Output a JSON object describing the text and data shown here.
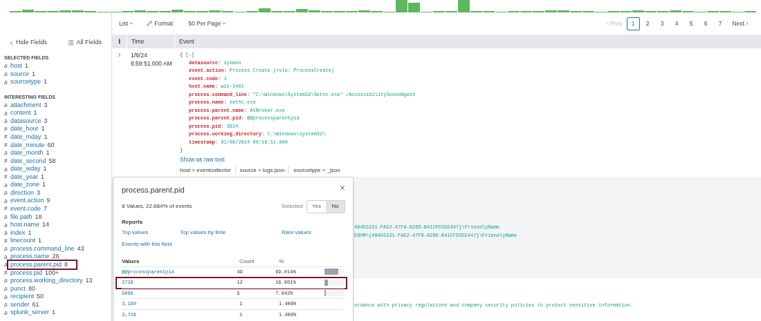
{
  "toolbar": {
    "list_menu": "List",
    "format_button": "Format",
    "per_page_menu": "50 Per Page"
  },
  "pagination": {
    "prev": {
      "label": "Prev",
      "disabled": true
    },
    "pages": [
      {
        "label": "1",
        "selected": true
      },
      {
        "label": "2",
        "selected": false
      },
      {
        "label": "3",
        "selected": false
      },
      {
        "label": "4",
        "selected": false
      },
      {
        "label": "5",
        "selected": false
      },
      {
        "label": "6",
        "selected": false
      },
      {
        "label": "7",
        "selected": false
      }
    ],
    "next": {
      "label": "Next",
      "disabled": false
    }
  },
  "sidebar": {
    "hide_fields": "Hide Fields",
    "all_fields": "All Fields",
    "selected_header": "SELECTED FIELDS",
    "selected_fields": [
      {
        "type": "a",
        "name": "host",
        "count": "1",
        "highlighted": false
      },
      {
        "type": "a",
        "name": "source",
        "count": "1",
        "highlighted": false
      },
      {
        "type": "a",
        "name": "sourcetype",
        "count": "1",
        "highlighted": false
      }
    ],
    "interesting_header": "INTERESTING FIELDS",
    "interesting_fields": [
      {
        "type": "a",
        "name": "attachment",
        "count": "3",
        "highlighted": false
      },
      {
        "type": "a",
        "name": "content",
        "count": "1",
        "highlighted": false
      },
      {
        "type": "a",
        "name": "datasource",
        "count": "3",
        "highlighted": false
      },
      {
        "type": "#",
        "name": "date_hour",
        "count": "1",
        "highlighted": false
      },
      {
        "type": "#",
        "name": "date_mday",
        "count": "1",
        "highlighted": false
      },
      {
        "type": "#",
        "name": "date_minute",
        "count": "60",
        "highlighted": false
      },
      {
        "type": "a",
        "name": "date_month",
        "count": "1",
        "highlighted": false
      },
      {
        "type": "#",
        "name": "date_second",
        "count": "58",
        "highlighted": false
      },
      {
        "type": "a",
        "name": "date_wday",
        "count": "1",
        "highlighted": false
      },
      {
        "type": "#",
        "name": "date_year",
        "count": "1",
        "highlighted": false
      },
      {
        "type": "a",
        "name": "date_zone",
        "count": "1",
        "highlighted": false
      },
      {
        "type": "a",
        "name": "direction",
        "count": "3",
        "highlighted": false
      },
      {
        "type": "a",
        "name": "event.action",
        "count": "9",
        "highlighted": false
      },
      {
        "type": "#",
        "name": "event.code",
        "count": "7",
        "highlighted": false
      },
      {
        "type": "a",
        "name": "file.path",
        "count": "18",
        "highlighted": false
      },
      {
        "type": "a",
        "name": "host.name",
        "count": "14",
        "highlighted": false
      },
      {
        "type": "a",
        "name": "index",
        "count": "1",
        "highlighted": false
      },
      {
        "type": "#",
        "name": "linecount",
        "count": "1",
        "highlighted": false
      },
      {
        "type": "a",
        "name": "process.command_line",
        "count": "43",
        "highlighted": false
      },
      {
        "type": "a",
        "name": "process.name",
        "count": "26",
        "highlighted": false
      },
      {
        "type": "a",
        "name": "process.parent.pid",
        "count": "8",
        "highlighted": true
      },
      {
        "type": "#",
        "name": "process.pid",
        "count": "100+",
        "highlighted": false
      },
      {
        "type": "a",
        "name": "process.working_directory",
        "count": "13",
        "highlighted": false
      },
      {
        "type": "a",
        "name": "punct",
        "count": "80",
        "highlighted": false
      },
      {
        "type": "a",
        "name": "recipient",
        "count": "50",
        "highlighted": false
      },
      {
        "type": "a",
        "name": "sender",
        "count": "61",
        "highlighted": false
      },
      {
        "type": "a",
        "name": "splunk_server",
        "count": "1",
        "highlighted": false
      }
    ]
  },
  "table": {
    "columns": [
      "i",
      "Time",
      "Event"
    ],
    "event": {
      "separator": ":",
      "meta_separator": "=",
      "date": "1/8/24",
      "time": "8:59:51.000 AM",
      "open_brace": "{",
      "collapse_link": "[-]",
      "fields": [
        {
          "key": "datasource",
          "value": "sysmon"
        },
        {
          "key": "event.action",
          "value": "Process Create (rule: ProcessCreate)"
        },
        {
          "key": "event.code",
          "value": "1"
        },
        {
          "key": "host.name",
          "value": "win-3461"
        },
        {
          "key": "process.command_line",
          "value": "\"C:\\Windows\\System32\\Sethc.exe\" /AccessibilitySoundAgent"
        },
        {
          "key": "process.name",
          "value": "sethc.exe"
        },
        {
          "key": "process.parent.name",
          "value": "AtBroker.exe"
        },
        {
          "key": "process.parent.pid",
          "value": "@@processparentpid"
        },
        {
          "key": "process.pid",
          "value": "3924"
        },
        {
          "key": "process.working_directory",
          "value": "C:\\Windows\\system32\\"
        },
        {
          "key": "timestamp",
          "value": "01/08/2024 08:59:51.000"
        }
      ],
      "close_brace": "}",
      "raw_text_link": "Show as raw text",
      "meta": [
        {
          "key": "host",
          "value": "eventcollector"
        },
        {
          "key": "source",
          "value": "logs.json"
        },
        {
          "key": "sourcetype",
          "value": "_json"
        }
      ]
    },
    "event_2_lines": [
      "49455221-FA52-47F9-826D-B41CFD35E447}\\FriendlyName",
      "ENUM\\{49455221-FA52-47F9-826D-B41CFD35E447}\\FriendlyName"
    ],
    "event_3_line": "ordance with privacy regulations and company security policies to protect sensitive information."
  },
  "popup": {
    "title": "process.parent.pid",
    "summary": "8 Values, 22.684% of events",
    "selected_label": "Selected",
    "toggle": [
      {
        "label": "Yes",
        "selected": false
      },
      {
        "label": "No",
        "selected": true
      }
    ],
    "reports_header": "Reports",
    "reports": [
      "Top values",
      "Top values by time",
      "Rare values",
      "Events with this field"
    ],
    "columns": [
      "Values",
      "Count",
      "%"
    ],
    "values": [
      {
        "value": "@@processparentpid",
        "count": "49",
        "percent": "69.014%",
        "level": 0.69014,
        "highlighted": false
      },
      {
        "value": "3728",
        "count": "12",
        "percent": "16.901%",
        "level": 0.16901,
        "highlighted": true
      },
      {
        "value": "9060",
        "count": "5",
        "percent": "7.042%",
        "level": 0.07042,
        "highlighted": false
      },
      {
        "value": "3,180",
        "count": "1",
        "percent": "1.408%",
        "highlighted": false
      },
      {
        "value": "3,728",
        "count": "1",
        "percent": "1.408%",
        "highlighted": false
      }
    ]
  }
}
